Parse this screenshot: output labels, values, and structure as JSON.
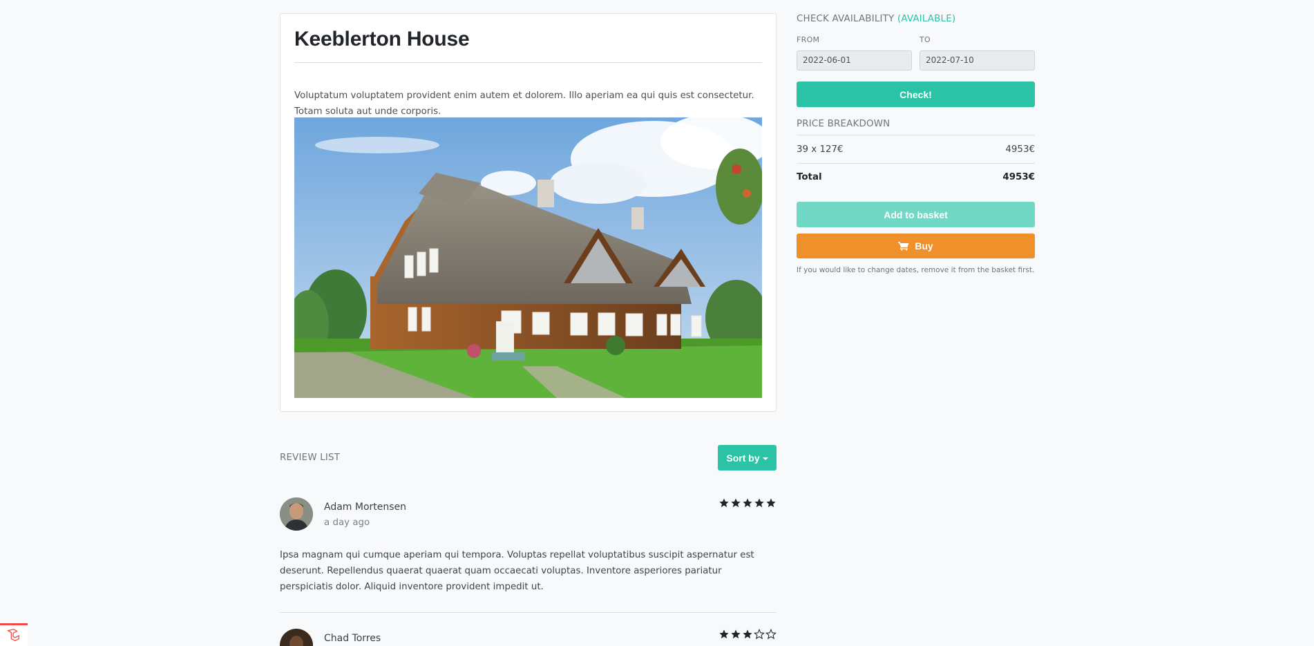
{
  "listing": {
    "title": "Keeblerton House",
    "description": "Voluptatum voluptatem provident enim autem et dolorem. Illo aperiam ea qui quis est consectetur. Totam soluta aut unde corporis."
  },
  "reviews": {
    "heading": "REVIEW LIST",
    "sort_label": "Sort by",
    "items": [
      {
        "name": "Adam Mortensen",
        "time": "a day ago",
        "rating": 5,
        "text": "Ipsa magnam qui cumque aperiam qui tempora. Voluptas repellat voluptatibus suscipit aspernatur est deserunt. Repellendus quaerat quaerat quam occaecati voluptas. Inventore asperiores pariatur perspiciatis dolor. Aliquid inventore provident impedit ut."
      },
      {
        "name": "Chad Torres",
        "rating": 3
      }
    ]
  },
  "availability": {
    "heading": "CHECK AVAILABILITY",
    "status": "(AVAILABLE)",
    "from_label": "FROM",
    "to_label": "TO",
    "from_value": "2022-06-01",
    "to_value": "2022-07-10",
    "check_label": "Check!"
  },
  "price": {
    "heading": "PRICE BREAKDOWN",
    "line_label": "39 x 127€",
    "line_value": "4953€",
    "total_label": "Total",
    "total_value": "4953€"
  },
  "actions": {
    "add_to_basket": "Add to basket",
    "buy": "Buy",
    "note": "If you would like to change dates, remove it from the basket first."
  },
  "colors": {
    "accent": "#2ac3a6",
    "accent_light": "#72d8c6",
    "buy": "#f0902a"
  },
  "icons": [
    "cart-icon",
    "star-icon",
    "caret-down-icon",
    "laravel-logo-icon"
  ]
}
